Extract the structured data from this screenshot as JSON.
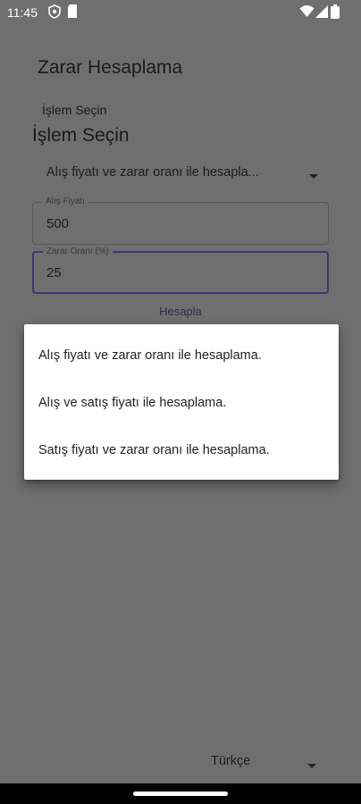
{
  "status_bar": {
    "time": "11:45",
    "icons": [
      "shield-icon",
      "sim-card-icon",
      "wifi-icon",
      "signal-icon",
      "battery-icon"
    ]
  },
  "app": {
    "title": "Zarar Hesaplama",
    "section_label_small": "İşlem Seçin",
    "section_label_large": "İşlem Seçin"
  },
  "operation_select": {
    "selected": "Alış fiyatı ve zarar oranı ile hesapla...",
    "options": [
      "Alış fiyatı ve zarar oranı ile hesaplama.",
      "Alış ve satış fiyatı ile hesaplama.",
      "Satış fiyatı ve zarar oranı ile hesaplama."
    ]
  },
  "purchase_price": {
    "label": "Alış Fiyatı",
    "value": "500"
  },
  "loss_rate": {
    "label": "Zarar Oranı (%)",
    "value": "25"
  },
  "calculate_button": {
    "label": "Hesapla"
  },
  "language_select": {
    "selected": "Türkçe"
  },
  "colors": {
    "scrim_background": "#6f6f6f",
    "menu_background": "#ffffff",
    "accent": "#3c3675",
    "navigation_bar": "#000000"
  }
}
